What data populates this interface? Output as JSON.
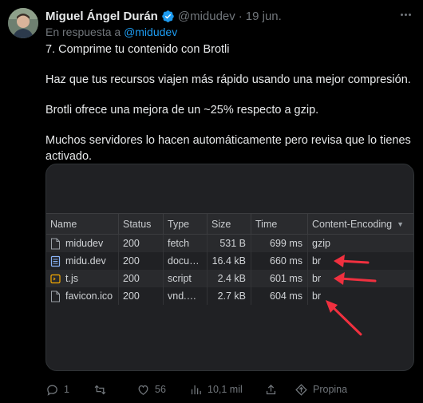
{
  "tweet": {
    "author_name": "Miguel Ángel Durán",
    "handle": "@midudev",
    "separator": "·",
    "date": "19 jun.",
    "reply_prefix": "En respuesta a",
    "reply_mention": "@midudev",
    "lines": [
      "7. Comprime tu contenido con Brotli",
      "Haz que tus recursos viajen más rápido usando una mejor compresión.",
      "Brotli ofrece una mejora de un ~25% respecto a gzip.",
      "Muchos servidores lo hacen automáticamente pero revisa que lo tienes",
      "activado."
    ]
  },
  "devtools": {
    "columns": [
      "Name",
      "Status",
      "Type",
      "Size",
      "Time",
      "Content-Encoding"
    ],
    "sort_indicator": "▼",
    "rows": [
      {
        "name": "midudev",
        "status": "200",
        "type": "fetch",
        "size": "531 B",
        "time": "699 ms",
        "encoding": "gzip",
        "icon": "file-icon"
      },
      {
        "name": "midu.dev",
        "status": "200",
        "type": "docu…",
        "size": "16.4 kB",
        "time": "660 ms",
        "encoding": "br",
        "icon": "document-icon"
      },
      {
        "name": "t.js",
        "status": "200",
        "type": "script",
        "size": "2.4 kB",
        "time": "601 ms",
        "encoding": "br",
        "icon": "script-icon"
      },
      {
        "name": "favicon.ico",
        "status": "200",
        "type": "vnd.…",
        "size": "2.7 kB",
        "time": "604 ms",
        "encoding": "br",
        "icon": "file-icon"
      }
    ]
  },
  "actions": {
    "replies": "1",
    "retweets": "",
    "likes": "56",
    "views": "10,1 mil",
    "promote": "Propina"
  },
  "colors": {
    "background": "#000000",
    "text": "#e7e9ea",
    "muted": "#71767b",
    "accent": "#1d9bf0",
    "annotation_arrow": "#f0303f"
  }
}
